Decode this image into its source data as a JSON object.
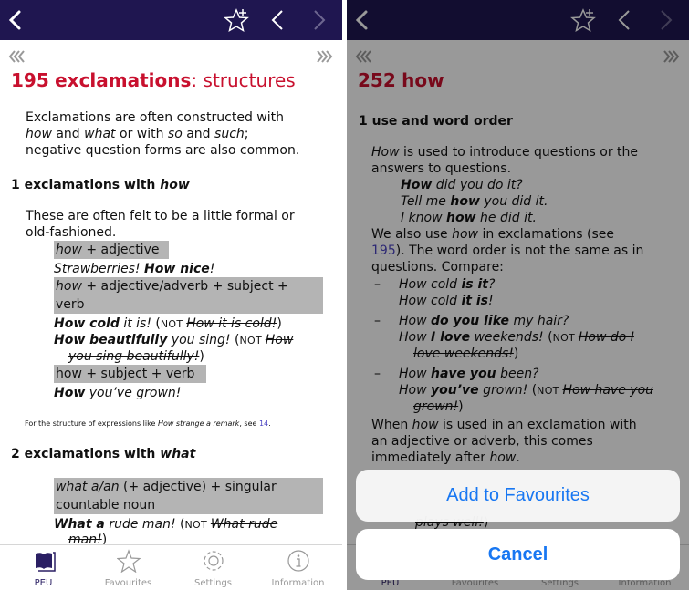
{
  "colors": {
    "header": "#1f1650",
    "title": "#c8102e",
    "link": "#4b44c2",
    "action": "#1877f2",
    "highlight": "#b4b4b4"
  },
  "icons": {
    "back": "chevron-left-icon",
    "favourite": "star-plus-icon",
    "prev": "chevron-left-icon",
    "next": "chevron-right-icon",
    "first": "triple-chevron-left-icon",
    "last": "triple-chevron-right-icon"
  },
  "tabs": [
    {
      "label": "PEU",
      "icon": "book-icon",
      "active": true
    },
    {
      "label": "Favourites",
      "icon": "star-icon"
    },
    {
      "label": "Settings",
      "icon": "gear-icon"
    },
    {
      "label": "Information",
      "icon": "info-icon"
    }
  ],
  "left": {
    "title_num": "195",
    "title_bold": "exclamations",
    "title_rest": ": structures",
    "lines": [
      {
        "segs": [
          [
            "r",
            "Exclamations are often constructed with"
          ]
        ]
      },
      {
        "segs": [
          [
            "i",
            "how"
          ],
          [
            "r",
            " and "
          ],
          [
            "i",
            "what"
          ],
          [
            "r",
            " or with "
          ],
          [
            "i",
            "so"
          ],
          [
            "r",
            " and "
          ],
          [
            "i",
            "such"
          ],
          [
            "r",
            ";"
          ]
        ]
      },
      {
        "segs": [
          [
            "r",
            "negative question forms are also common."
          ]
        ]
      },
      {
        "segs": [
          [
            "r",
            "1 exclamations with "
          ],
          [
            "bi",
            "how"
          ]
        ]
      },
      {
        "segs": [
          [
            "r",
            "These are often felt to be a little formal or"
          ]
        ]
      },
      {
        "segs": [
          [
            "r",
            "old-fashioned."
          ]
        ]
      },
      {
        "segs": [
          [
            "i",
            "how"
          ],
          [
            "r",
            " + adjective"
          ]
        ]
      },
      {
        "segs": [
          [
            "i",
            "Strawberries! "
          ],
          [
            "bi",
            "How nice"
          ],
          [
            "i",
            "!"
          ]
        ]
      },
      {
        "segs": [
          [
            "i",
            "how"
          ],
          [
            "r",
            " + adjective/adverb + subject +"
          ]
        ]
      },
      {
        "segs": [
          [
            "r",
            "verb"
          ]
        ]
      },
      {
        "segs": [
          [
            "bi",
            "How cold"
          ],
          [
            "i",
            " it is!"
          ],
          [
            "r",
            " ("
          ],
          [
            "sc",
            "NOT "
          ],
          [
            "si",
            "How it is cold!"
          ],
          [
            "r",
            ")"
          ]
        ]
      },
      {
        "segs": [
          [
            "bi",
            "How beautifully"
          ],
          [
            "i",
            " you sing!"
          ],
          [
            "r",
            " ("
          ],
          [
            "sc",
            "NOT "
          ],
          [
            "si",
            "How"
          ]
        ]
      },
      {
        "segs": [
          [
            "si",
            "you sing beautifully!"
          ],
          [
            "r",
            ")"
          ]
        ]
      },
      {
        "segs": [
          [
            "r",
            "how + subject + verb"
          ]
        ]
      },
      {
        "segs": [
          [
            "bi",
            "How"
          ],
          [
            "i",
            " you’ve grown!"
          ]
        ]
      },
      {
        "segs": [
          [
            "r",
            "For the structure of expressions like "
          ],
          [
            "i",
            "How strange a remark"
          ],
          [
            "r",
            ", see "
          ],
          [
            "link",
            "14"
          ],
          [
            "r",
            "."
          ]
        ]
      },
      {
        "segs": [
          [
            "r",
            "2 exclamations with "
          ],
          [
            "bi",
            "what"
          ]
        ]
      },
      {
        "segs": [
          [
            "i",
            "what a/an"
          ],
          [
            "r",
            " (+ adjective) + singular"
          ]
        ]
      },
      {
        "segs": [
          [
            "r",
            "countable noun"
          ]
        ]
      },
      {
        "segs": [
          [
            "bi",
            "What a"
          ],
          [
            "i",
            " rude man!"
          ],
          [
            "r",
            " ("
          ],
          [
            "sc",
            "NOT "
          ],
          [
            "si",
            "What rude"
          ]
        ]
      },
      {
        "segs": [
          [
            "si",
            "man!"
          ],
          [
            "r",
            ")"
          ]
        ]
      }
    ]
  },
  "right": {
    "title_num": "252",
    "title_bold": "how",
    "title_rest": "",
    "lines": [
      {
        "segs": [
          [
            "r",
            "1 use and word order"
          ]
        ]
      },
      {
        "segs": [
          [
            "i",
            "How"
          ],
          [
            "r",
            " is used to introduce questions or the"
          ]
        ]
      },
      {
        "segs": [
          [
            "r",
            "answers to questions."
          ]
        ]
      },
      {
        "segs": [
          [
            "bi",
            "How"
          ],
          [
            "i",
            " did you do it?"
          ]
        ]
      },
      {
        "segs": [
          [
            "i",
            "Tell me "
          ],
          [
            "bi",
            "how"
          ],
          [
            "i",
            " you did it."
          ]
        ]
      },
      {
        "segs": [
          [
            "i",
            "I know "
          ],
          [
            "bi",
            "how"
          ],
          [
            "i",
            " he did it."
          ]
        ]
      },
      {
        "segs": [
          [
            "r",
            "We also use "
          ],
          [
            "i",
            "how"
          ],
          [
            "r",
            " in exclamations (see"
          ]
        ]
      },
      {
        "segs": [
          [
            "link",
            "195"
          ],
          [
            "r",
            "). The word order is not the same as in"
          ]
        ]
      },
      {
        "segs": [
          [
            "r",
            "questions. Compare:"
          ]
        ]
      },
      {
        "segs": [
          [
            "r",
            "–"
          ]
        ]
      },
      {
        "segs": [
          [
            "i",
            "How cold "
          ],
          [
            "bi",
            "is it"
          ],
          [
            "i",
            "?"
          ]
        ]
      },
      {
        "segs": [
          [
            "i",
            "How cold "
          ],
          [
            "bi",
            "it is"
          ],
          [
            "i",
            "!"
          ]
        ]
      },
      {
        "segs": [
          [
            "r",
            "–"
          ]
        ]
      },
      {
        "segs": [
          [
            "i",
            "How "
          ],
          [
            "bi",
            "do you like"
          ],
          [
            "i",
            " my hair?"
          ]
        ]
      },
      {
        "segs": [
          [
            "i",
            "How "
          ],
          [
            "bi",
            "I love"
          ],
          [
            "i",
            " weekends!"
          ],
          [
            "r",
            " ("
          ],
          [
            "sc",
            "NOT "
          ],
          [
            "si",
            "How do I"
          ]
        ]
      },
      {
        "segs": [
          [
            "si",
            "love weekends!"
          ],
          [
            "r",
            ")"
          ]
        ]
      },
      {
        "segs": [
          [
            "r",
            "–"
          ]
        ]
      },
      {
        "segs": [
          [
            "i",
            "How "
          ],
          [
            "bi",
            "have you"
          ],
          [
            "i",
            " been?"
          ]
        ]
      },
      {
        "segs": [
          [
            "i",
            "How "
          ],
          [
            "bi",
            "you’ve"
          ],
          [
            "i",
            " grown!"
          ],
          [
            "r",
            " ("
          ],
          [
            "sc",
            "NOT "
          ],
          [
            "si",
            "How have you"
          ]
        ]
      },
      {
        "segs": [
          [
            "si",
            "grown!"
          ],
          [
            "r",
            ")"
          ]
        ]
      },
      {
        "segs": [
          [
            "r",
            "When "
          ],
          [
            "i",
            "how"
          ],
          [
            "r",
            " is used in an exclamation with"
          ]
        ]
      },
      {
        "segs": [
          [
            "r",
            "an adjective or adverb, this comes"
          ]
        ]
      },
      {
        "segs": [
          [
            "r",
            "immediately after "
          ],
          [
            "i",
            "how"
          ],
          [
            "r",
            "."
          ]
        ]
      },
      {
        "segs": [
          [
            "si",
            "plays well!"
          ],
          [
            "r",
            ")"
          ]
        ]
      }
    ]
  },
  "sheet": {
    "add_label": "Add to Favourites",
    "cancel_label": "Cancel"
  }
}
